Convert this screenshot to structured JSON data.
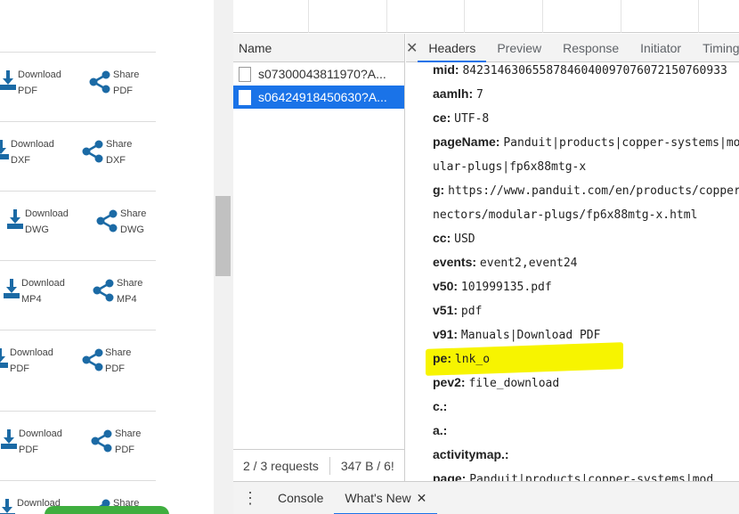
{
  "left_panel": {
    "rows": [
      {
        "download_label": "Download",
        "download_type": "PDF",
        "share_label": "Share",
        "share_type": "PDF"
      },
      {
        "download_label": "Download",
        "download_type": "DXF",
        "share_label": "Share",
        "share_type": "DXF"
      },
      {
        "download_label": "Download",
        "download_type": "DWG",
        "share_label": "Share",
        "share_type": "DWG"
      },
      {
        "download_label": "Download",
        "download_type": "MP4",
        "share_label": "Share",
        "share_type": "MP4"
      },
      {
        "download_label": "Download",
        "download_type": "PDF",
        "share_label": "Share",
        "share_type": "PDF"
      },
      {
        "download_label": "Download",
        "download_type": "PDF",
        "share_label": "Share",
        "share_type": "PDF"
      },
      {
        "download_label": "Download",
        "download_type": "",
        "share_label": "Share",
        "share_type": ""
      }
    ],
    "icon_color": "#1b6aa5",
    "pill_color": "#3fae3f"
  },
  "devtools": {
    "name_header": "Name",
    "requests": [
      {
        "name": "s07300043811970?A...",
        "selected": false
      },
      {
        "name": "s06424918450630?A...",
        "selected": true
      }
    ],
    "footer": {
      "requests": "2 / 3 requests",
      "size": "347 B / 6!"
    },
    "tabs": [
      "Headers",
      "Preview",
      "Response",
      "Initiator",
      "Timing"
    ],
    "active_tab": "Headers",
    "params": [
      {
        "key": "mid:",
        "value": "84231463065587846040097076072150760933"
      },
      {
        "key": "aamlh:",
        "value": "7"
      },
      {
        "key": "ce:",
        "value": "UTF-8"
      },
      {
        "key": "pageName:",
        "value": "Panduit|products|copper-systems|mod"
      },
      {
        "key": "",
        "value": "ular-plugs|fp6x88mtg-x"
      },
      {
        "key": "g:",
        "value": "https://www.panduit.com/en/products/copper-systems/con"
      },
      {
        "key": "",
        "value": "nectors/modular-plugs/fp6x88mtg-x.html"
      },
      {
        "key": "cc:",
        "value": "USD"
      },
      {
        "key": "events:",
        "value": "event2,event24"
      },
      {
        "key": "v50:",
        "value": "101999135.pdf"
      },
      {
        "key": "v51:",
        "value": "pdf"
      },
      {
        "key": "v91:",
        "value": "Manuals|Download PDF"
      },
      {
        "key": "pe:",
        "value": "lnk_o"
      },
      {
        "key": "pev2:",
        "value": "file_download"
      },
      {
        "key": "c.:",
        "value": ""
      },
      {
        "key": "a.:",
        "value": ""
      },
      {
        "key": "activitymap.:",
        "value": ""
      },
      {
        "key": "page:",
        "value": "Panduit|products|copper-systems|mod"
      }
    ],
    "highlight_color": "#f7f400",
    "drawer_tabs": [
      "Console",
      "What's New"
    ],
    "drawer_active": "What's New"
  }
}
